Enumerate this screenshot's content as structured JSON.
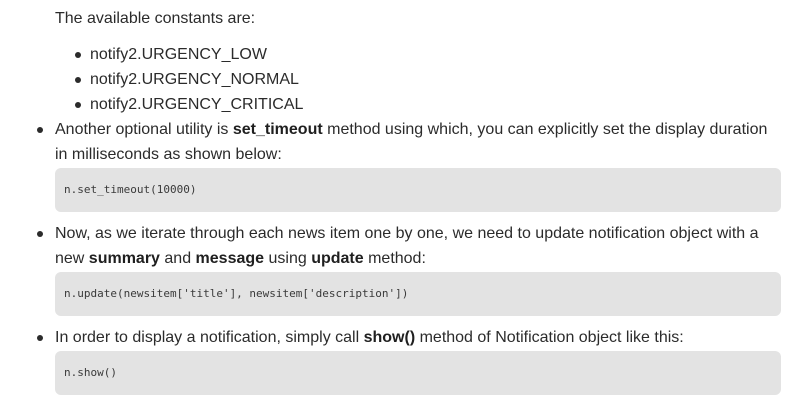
{
  "intro": "The available constants are:",
  "constants": [
    "notify2.URGENCY_LOW",
    "notify2.URGENCY_NORMAL",
    "notify2.URGENCY_CRITICAL"
  ],
  "item1": {
    "pre": "Another optional utility is ",
    "bold": "set_timeout",
    "post": " method using which, you can explicitly set the display duration",
    "line2": "in milliseconds as shown below:",
    "code": "n.set_timeout(10000)"
  },
  "item2": {
    "line1": "Now, as we iterate through each news item one by one, we need to update notification object with a",
    "pre": "new ",
    "bold1": "summary",
    "mid1": " and ",
    "bold2": "message",
    "mid2": " using ",
    "bold3": "update",
    "post": " method:",
    "code": "n.update(newsitem['title'], newsitem['description'])"
  },
  "item3": {
    "pre": "In order to display a notification, simply call ",
    "bold": "show()",
    "post": " method of Notification object like this:",
    "code": "n.show()"
  }
}
